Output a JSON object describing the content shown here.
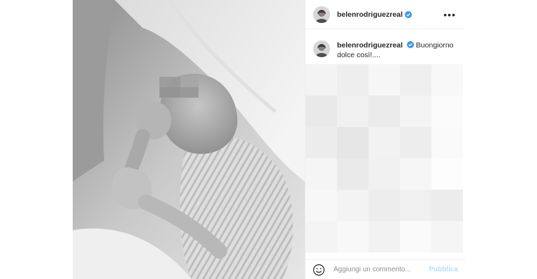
{
  "post": {
    "username": "belenrodriguezreal",
    "verified_icon": "verified-badge-icon",
    "more_icon": "more-options-icon",
    "more_symbol": "•••",
    "caption": {
      "username": "belenrodriguezreal",
      "text": "Buongiorno dolce così!...."
    }
  },
  "comment_bar": {
    "emoji_icon": "emoji-icon",
    "placeholder": "Aggiungi un commento...",
    "publish_label": "Pubblica"
  },
  "colors": {
    "verified_blue": "#3897f0",
    "publish_disabled": "#b2dffc",
    "divider": "#efefef"
  }
}
